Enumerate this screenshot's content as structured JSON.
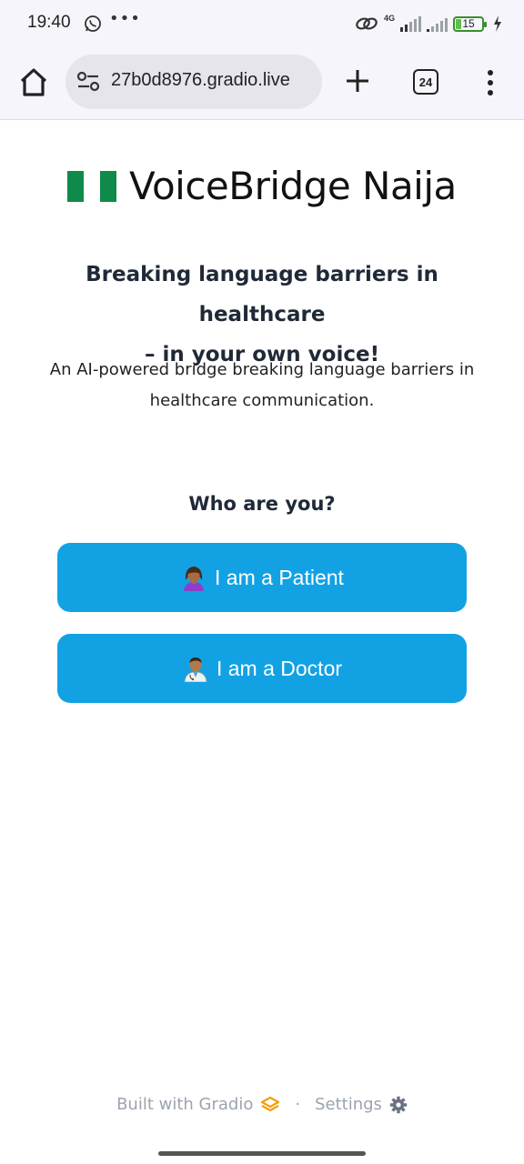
{
  "status_bar": {
    "time": "19:40",
    "icons": [
      "whatsapp-icon",
      "more-notifications-icon",
      "link-icon",
      "signal-icon",
      "battery-icon",
      "charging-icon"
    ],
    "network": "4G",
    "battery": "15",
    "colors": {
      "battery_fill": "#5cc04a"
    }
  },
  "browser": {
    "url": "27b0d8976.gradio.live",
    "tab_count": "24",
    "icons": [
      "home-icon",
      "site-settings-icon",
      "plus-icon",
      "tabs-icon",
      "menu-icon"
    ]
  },
  "page": {
    "title": "VoiceBridge Naija",
    "flag_icon": "nigeria-flag-icon",
    "subtitle_line1": "Breaking language barriers in healthcare",
    "subtitle_line2": "– in your own voice!",
    "description_line1": "An AI-powered bridge breaking language barriers in",
    "description_line2": "healthcare communication.",
    "question": "Who are you?",
    "buttons": [
      {
        "label": "I am a Patient",
        "icon": "woman-icon"
      },
      {
        "label": "I am a Doctor",
        "icon": "health-worker-icon"
      }
    ],
    "colors": {
      "button_bg": "#12a2e4",
      "button_text": "#ffffff"
    }
  },
  "footer": {
    "built_with": "Built with Gradio",
    "separator": "·",
    "settings": "Settings",
    "icons": [
      "gradio-logo-icon",
      "gear-icon"
    ]
  }
}
